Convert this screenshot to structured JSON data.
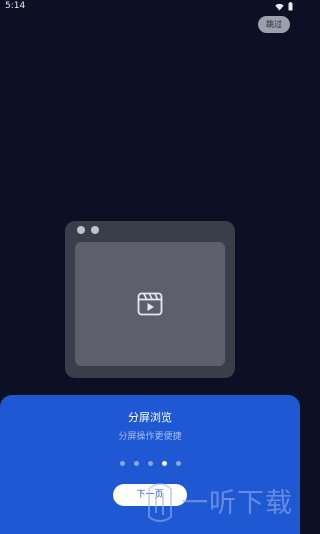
{
  "status_bar": {
    "time": "5:14"
  },
  "onboarding": {
    "skip_label": "跳过",
    "title": "分屏浏览",
    "subtitle": "分屏操作更便捷",
    "next_label": "下一页",
    "page_count": 5,
    "active_page": 4
  },
  "watermark": {
    "text": "一听下载"
  },
  "colors": {
    "background": "#0c1024",
    "card": "#1e58d3",
    "mock_window": "#3a3d4a",
    "mock_screen": "#5d606c"
  },
  "icons": [
    "wifi-icon",
    "battery-icon",
    "video-clip-icon",
    "watermark-logo-icon"
  ]
}
